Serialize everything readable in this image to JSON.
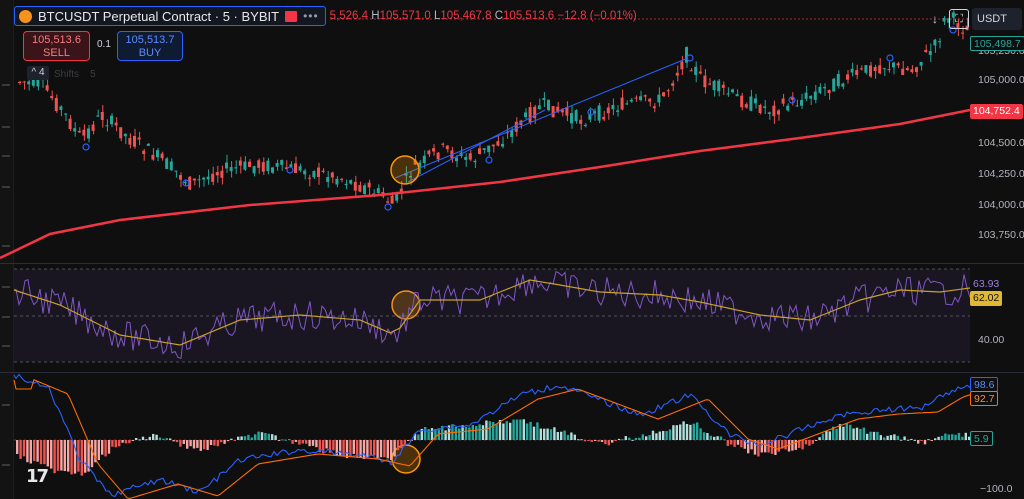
{
  "header": {
    "symbol_title": "BTCUSDT Perpetual Contract · 5 · BYBIT",
    "more": "•••",
    "ohlc_open_partial": "5,526.4",
    "ohlc_high_key": "H",
    "ohlc_high": "105,571.0",
    "ohlc_low_key": "L",
    "ohlc_low": "105,467.8",
    "ohlc_close_key": "C",
    "ohlc_close": "105,513.6",
    "ohlc_change": "−12.8 (−0.01%)"
  },
  "trade": {
    "sell_price": "105,513.6",
    "sell_label": "SELL",
    "spread": "0.1",
    "buy_price": "105,513.7",
    "buy_label": "BUY"
  },
  "controls": {
    "collapse_count": "4",
    "faded_a": "Shifts",
    "faded_b": "5",
    "currency": "USDT",
    "scroll_arrow": "↓",
    "fullscreen": "⛶"
  },
  "price_axis": {
    "labels": [
      "105,250.0",
      "105,000.0",
      "104,500.0",
      "104,250.0",
      "104,000.0",
      "103,750.0"
    ],
    "current_price": "105,498.7",
    "ma_price": "104,752.4"
  },
  "rsi_axis": {
    "rsi_value": "63.93",
    "rsi_ma_value": "62.02",
    "level_label": "40.00"
  },
  "macd_axis": {
    "macd_value": "98.6",
    "signal_value": "92.7",
    "hist_value": "5.9",
    "bottom_label": "−100.0"
  },
  "colors": {
    "up": "#26a69a",
    "down": "#ef5350",
    "ma": "#f23645",
    "rsi": "#7e57c2",
    "rsi_ma": "#c9a227",
    "macd": "#2962ff",
    "signal": "#ff6d00"
  },
  "icons": {
    "logo": "tradingview-logo-icon",
    "flag": "flag-icon",
    "arrow": "scroll-down-arrow-icon",
    "fullscreen": "fullscreen-icon"
  }
}
